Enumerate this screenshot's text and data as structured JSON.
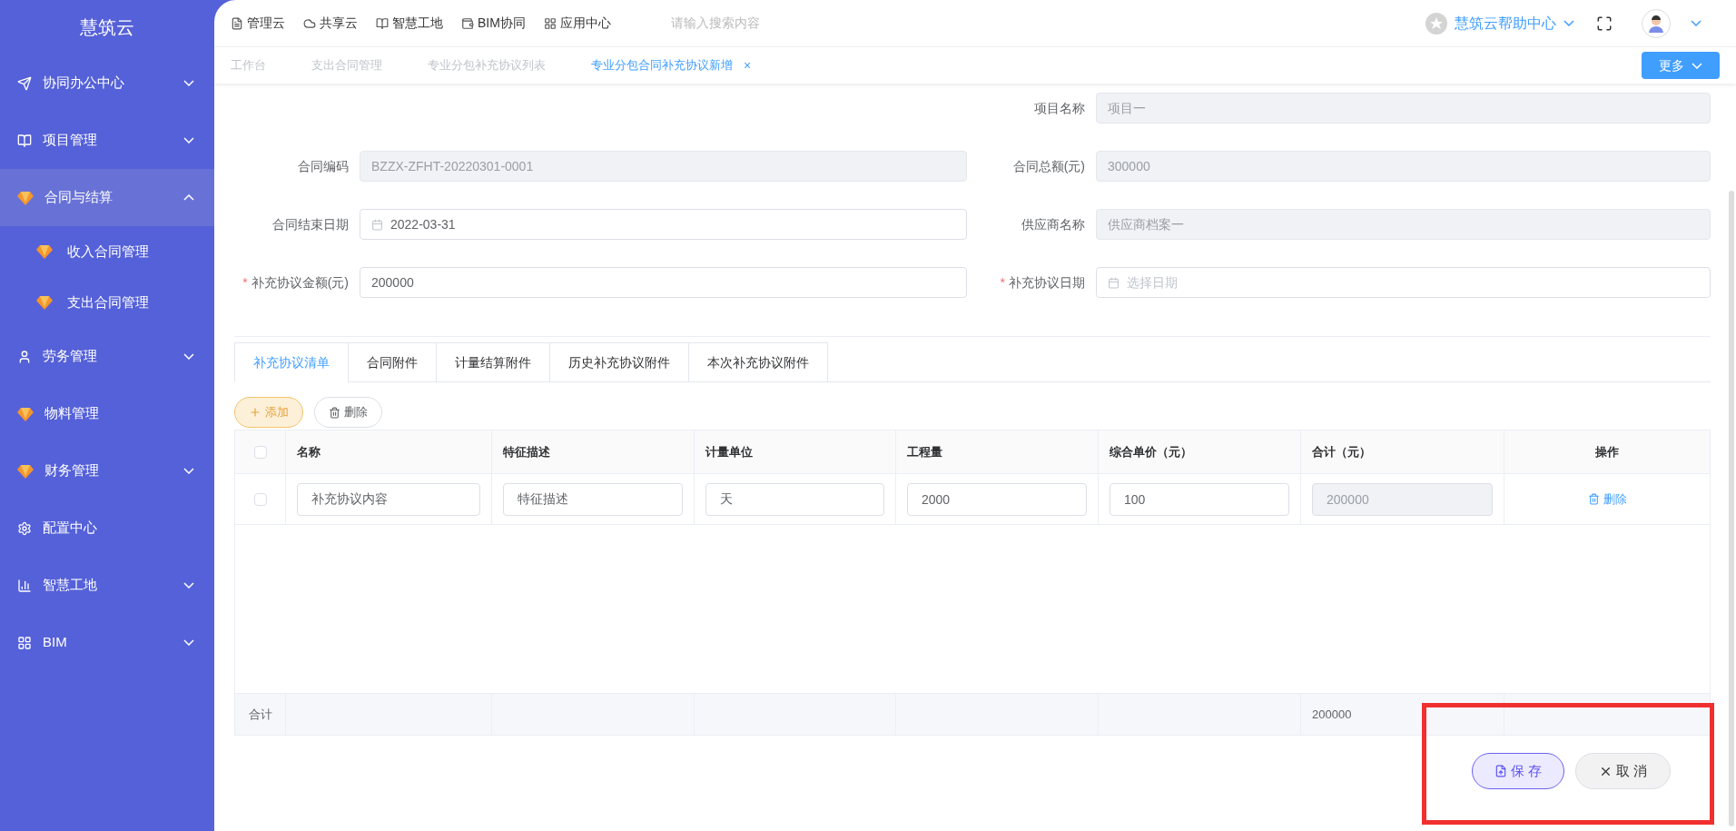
{
  "sidebar": {
    "logo": "慧筑云",
    "items": [
      {
        "label": "协同办公中心",
        "expanded": false,
        "selected": false
      },
      {
        "label": "项目管理",
        "expanded": false,
        "selected": false
      },
      {
        "label": "合同与结算",
        "expanded": true,
        "selected": true,
        "children": [
          {
            "label": "收入合同管理"
          },
          {
            "label": "支出合同管理"
          }
        ]
      },
      {
        "label": "劳务管理",
        "expanded": false,
        "selected": false
      },
      {
        "label": "物料管理",
        "selected": false
      },
      {
        "label": "财务管理",
        "expanded": false,
        "selected": false
      },
      {
        "label": "配置中心",
        "selected": false
      },
      {
        "label": "智慧工地",
        "expanded": false,
        "selected": false
      },
      {
        "label": "BIM",
        "expanded": false,
        "selected": false
      }
    ]
  },
  "topbar": {
    "links": [
      "管理云",
      "共享云",
      "智慧工地",
      "BIM协同",
      "应用中心"
    ],
    "search": {
      "placeholder": "请输入搜索内容"
    },
    "help": "慧筑云帮助中心"
  },
  "tabs": [
    {
      "label": "工作台",
      "selected": false
    },
    {
      "label": "支出合同管理",
      "selected": false
    },
    {
      "label": "专业分包补充协议列表",
      "selected": false
    },
    {
      "label": "专业分包合同补充协议新增",
      "selected": true,
      "close": "×"
    }
  ],
  "more_button": "更多",
  "form": {
    "rows": [
      [
        null,
        {
          "label": "项目名称",
          "kind": "text",
          "value": "项目一",
          "disabled": true
        }
      ],
      [
        {
          "label": "合同编码",
          "kind": "text",
          "value": "BZZX-ZFHT-20220301-0001",
          "disabled": true
        },
        {
          "label": "合同总额(元)",
          "kind": "text",
          "value": "300000",
          "disabled": true
        }
      ],
      [
        {
          "label": "合同结束日期",
          "kind": "date",
          "value": "2022-03-31",
          "disabled": false
        },
        {
          "label": "供应商名称",
          "kind": "text",
          "value": "供应商档案一",
          "disabled": true
        }
      ],
      [
        {
          "label": "补充协议金额(元)",
          "required_mark": "*",
          "kind": "text",
          "value": "200000",
          "disabled": false
        },
        {
          "label": "补充协议日期",
          "required_mark": "*",
          "kind": "date",
          "placeholder": "选择日期",
          "disabled": false
        }
      ]
    ]
  },
  "detail_tabs": [
    {
      "label": "补充协议清单",
      "selected": true
    },
    {
      "label": "合同附件",
      "selected": false
    },
    {
      "label": "计量结算附件",
      "selected": false
    },
    {
      "label": "历史补充协议附件",
      "selected": false
    },
    {
      "label": "本次补充协议附件",
      "selected": false
    }
  ],
  "actions": {
    "add": "添加",
    "delete": "删除"
  },
  "table": {
    "all_checked": false,
    "columns": [
      "名称",
      "特征描述",
      "计量单位",
      "工程量",
      "综合单价（元）",
      "合计（元）",
      "操作"
    ],
    "rows": [
      {
        "checked": false,
        "cells": [
          {
            "value": "补充协议内容",
            "disabled": false
          },
          {
            "value": "特征描述",
            "disabled": false
          },
          {
            "value": "天",
            "disabled": false
          },
          {
            "value": "2000",
            "disabled": false
          },
          {
            "value": "100",
            "disabled": false
          },
          {
            "value": "200000",
            "disabled": true
          }
        ],
        "action": "删除"
      }
    ],
    "total": {
      "label": "合计",
      "cells": [
        null,
        null,
        null,
        null,
        null,
        "200000",
        null
      ]
    }
  },
  "footer": {
    "save": "保 存",
    "cancel": "取 消"
  }
}
